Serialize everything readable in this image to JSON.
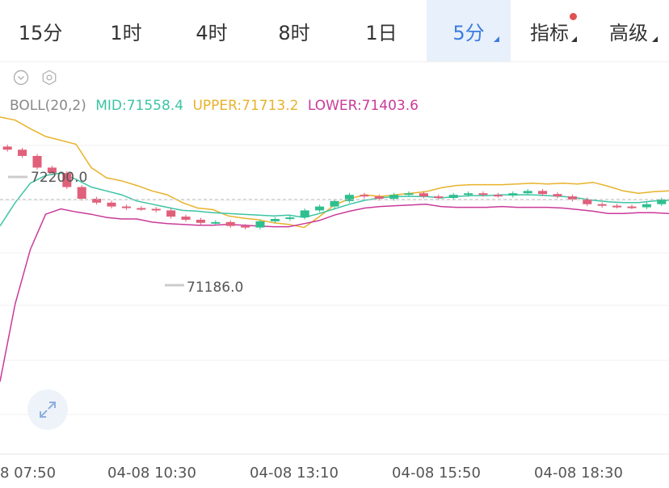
{
  "tabs": [
    {
      "label": "15分",
      "active": false,
      "dropdown": false,
      "dot": false
    },
    {
      "label": "1时",
      "active": false,
      "dropdown": false,
      "dot": false
    },
    {
      "label": "4时",
      "active": false,
      "dropdown": false,
      "dot": false
    },
    {
      "label": "8时",
      "active": false,
      "dropdown": false,
      "dot": false
    },
    {
      "label": "1日",
      "active": false,
      "dropdown": false,
      "dot": false
    },
    {
      "label": "5分",
      "active": true,
      "dropdown": true,
      "dot": false
    },
    {
      "label": "指标",
      "active": false,
      "dropdown": true,
      "dot": true
    },
    {
      "label": "高级",
      "active": false,
      "dropdown": true,
      "dot": false
    }
  ],
  "controls": {
    "collapse_icon": "chevron-down-circle-icon",
    "settings_icon": "hexagon-settings-icon",
    "expand_icon": "expand-arrows-icon"
  },
  "indicator": {
    "name": "BOLL(20,2)",
    "mid": "MID:71558.4",
    "upper": "UPPER:71713.2",
    "lower": "LOWER:71403.6"
  },
  "colors": {
    "up": "#2fbf8f",
    "down": "#e0607a",
    "mid": "#3cc4a4",
    "upper": "#e8b22a",
    "lower": "#c93a9a",
    "active_tab": "#3b7ddd"
  },
  "chart_data": {
    "type": "candlestick",
    "x_labels": [
      "8 07:50",
      "04-08 10:30",
      "04-08 13:10",
      "04-08 15:50",
      "04-08 18:30"
    ],
    "annotations": {
      "high": "72200.0",
      "low": "71186.0"
    },
    "upper": [
      72600,
      72560,
      72450,
      72350,
      72300,
      72250,
      71950,
      71820,
      71780,
      71720,
      71650,
      71600,
      71500,
      71430,
      71410,
      71330,
      71300,
      71280,
      71240,
      71220,
      71180,
      71320,
      71470,
      71550,
      71600,
      71580,
      71600,
      71620,
      71640,
      71690,
      71720,
      71730,
      71730,
      71730,
      71740,
      71750,
      71740,
      71750,
      71740,
      71760,
      71710,
      71650,
      71620,
      71640,
      71650
    ],
    "mid": [
      71200,
      71500,
      71750,
      71850,
      71880,
      71800,
      71700,
      71650,
      71600,
      71520,
      71480,
      71440,
      71400,
      71390,
      71370,
      71360,
      71350,
      71340,
      71330,
      71340,
      71310,
      71360,
      71420,
      71480,
      71530,
      71560,
      71580,
      71580,
      71580,
      71560,
      71580,
      71590,
      71590,
      71600,
      71600,
      71600,
      71590,
      71580,
      71560,
      71530,
      71510,
      71500,
      71500,
      71520,
      71530
    ],
    "lower": [
      69200,
      70200,
      70900,
      71350,
      71420,
      71380,
      71350,
      71310,
      71290,
      71290,
      71250,
      71230,
      71220,
      71210,
      71210,
      71220,
      71210,
      71200,
      71190,
      71190,
      71230,
      71270,
      71340,
      71390,
      71430,
      71450,
      71460,
      71470,
      71480,
      71450,
      71440,
      71440,
      71440,
      71450,
      71440,
      71440,
      71440,
      71430,
      71410,
      71390,
      71360,
      71360,
      71370,
      71370,
      71360
    ],
    "close": [
      72180,
      72100,
      71950,
      71880,
      71700,
      71550,
      71500,
      71450,
      71430,
      71420,
      71400,
      71320,
      71280,
      71240,
      71250,
      71200,
      71180,
      71260,
      71290,
      71310,
      71400,
      71450,
      71520,
      71600,
      71580,
      71550,
      71600,
      71620,
      71580,
      71560,
      71600,
      71620,
      71600,
      71590,
      71620,
      71650,
      71610,
      71580,
      71540,
      71480,
      71460,
      71450,
      71440,
      71480,
      71540
    ]
  }
}
